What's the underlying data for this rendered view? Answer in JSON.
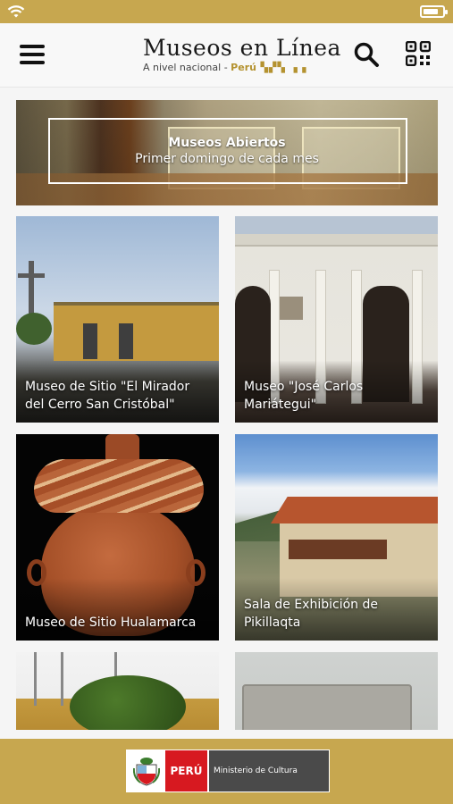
{
  "header": {
    "menu_icon": "hamburger-menu-icon",
    "title": "Museos en Línea",
    "subtitle_prefix": "A nivel nacional - ",
    "subtitle_country": "Perú",
    "search_icon": "search-icon",
    "qr_icon": "qr-code-icon"
  },
  "banner": {
    "title": "Museos Abiertos",
    "subtitle": "Primer domingo de cada mes"
  },
  "museums": [
    {
      "name": "Museo de Sitio \"El Mirador del Cerro San Cristóbal\""
    },
    {
      "name": "Museo \"José Carlos Mariátegui\""
    },
    {
      "name": "Museo de Sitio Hualamarca"
    },
    {
      "name": "Sala de Exhibición de Pikillaqta"
    },
    {
      "name": ""
    },
    {
      "name": ""
    }
  ],
  "footer": {
    "country": "PERÚ",
    "ministry": "Ministerio de Cultura"
  },
  "colors": {
    "accent_gold": "#c7a74f",
    "peru_red": "#d71920"
  }
}
